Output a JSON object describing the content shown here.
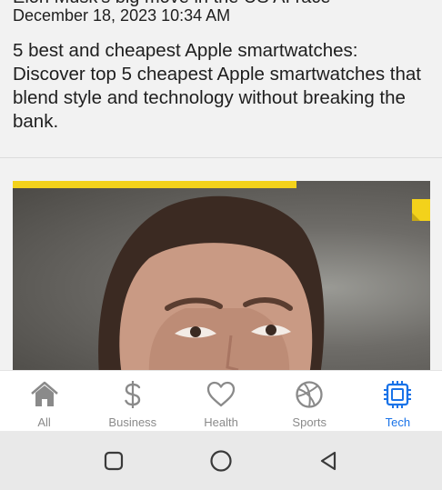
{
  "article": {
    "cut_title": "Elon Musk's big move in the US AI race",
    "timestamp": "December 18, 2023 10:34 AM",
    "text": "5 best and cheapest Apple smartwatches: Discover top 5 cheapest Apple smartwatches that blend style and technology without breaking the bank."
  },
  "colors": {
    "accent": "#1a73e8",
    "inactive": "#8a8a8a",
    "image_accent": "#f3d21b"
  },
  "bottom_nav": {
    "items": [
      {
        "label": "All",
        "icon": "home-icon",
        "active": false
      },
      {
        "label": "Business",
        "icon": "dollar-icon",
        "active": false
      },
      {
        "label": "Health",
        "icon": "heart-icon",
        "active": false
      },
      {
        "label": "Sports",
        "icon": "ball-icon",
        "active": false
      },
      {
        "label": "Tech",
        "icon": "chip-icon",
        "active": true
      }
    ]
  },
  "system_nav": {
    "buttons": [
      "recent-apps",
      "home",
      "back"
    ]
  }
}
